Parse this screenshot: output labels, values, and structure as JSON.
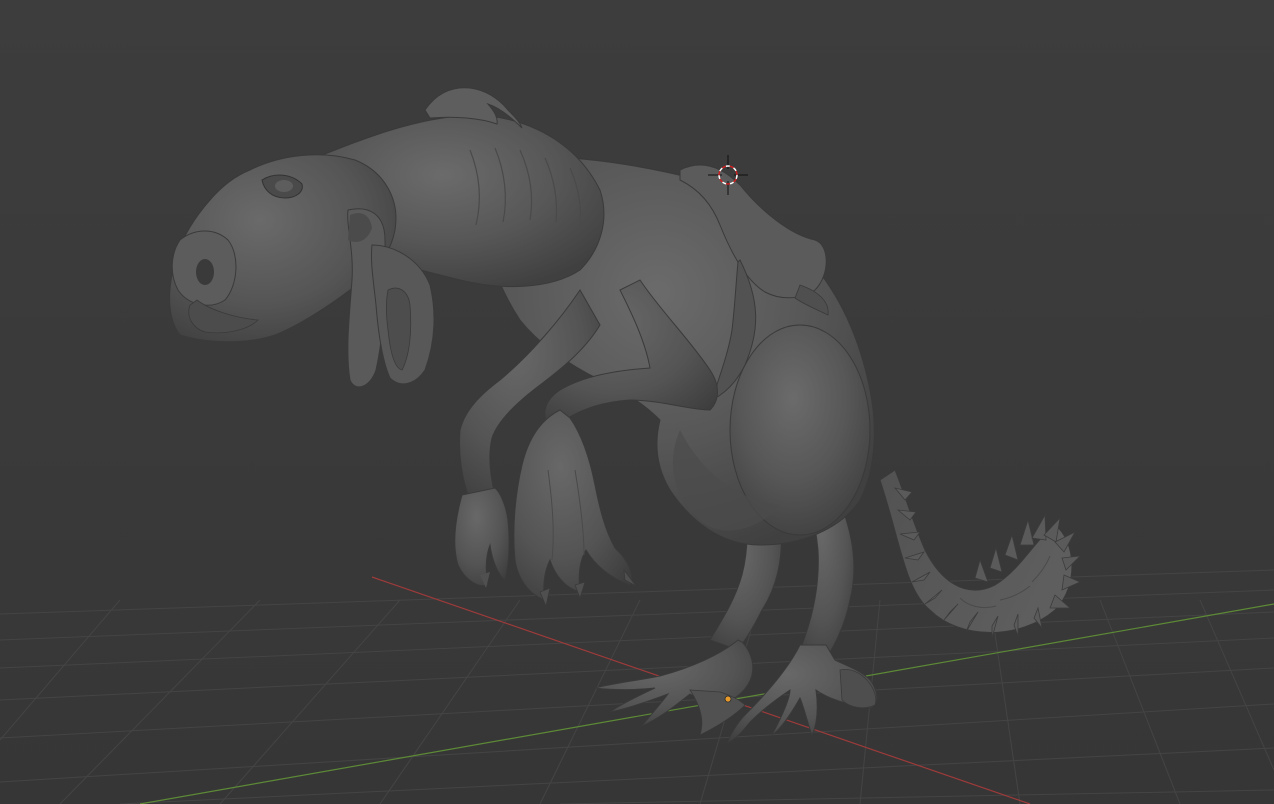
{
  "app": {
    "name": "3D viewport",
    "view_mode": "solid",
    "colors": {
      "background_top": "#3d3d3d",
      "background_bottom": "#363636",
      "grid_line": "#464646",
      "axis_x": "#9e3a3a",
      "axis_y": "#5d8a36",
      "model_base": "#565656",
      "model_highlight": "#6e6e6e",
      "model_shadow": "#3c3c3c",
      "cursor_ring_red": "#d02020",
      "cursor_ring_white": "#ffffff",
      "origin_point": "#e89a2a"
    }
  },
  "scene": {
    "object": {
      "kind": "sculpted creature mesh",
      "shading": "matcap-solid-gray",
      "selected": false
    },
    "grid": {
      "visible": true
    },
    "axes": {
      "x_visible": true,
      "y_visible": true
    },
    "cursor_3d": {
      "visible": true,
      "icon": "3d-cursor-icon"
    },
    "object_origin": {
      "visible": true,
      "icon": "origin-dot-icon"
    }
  }
}
